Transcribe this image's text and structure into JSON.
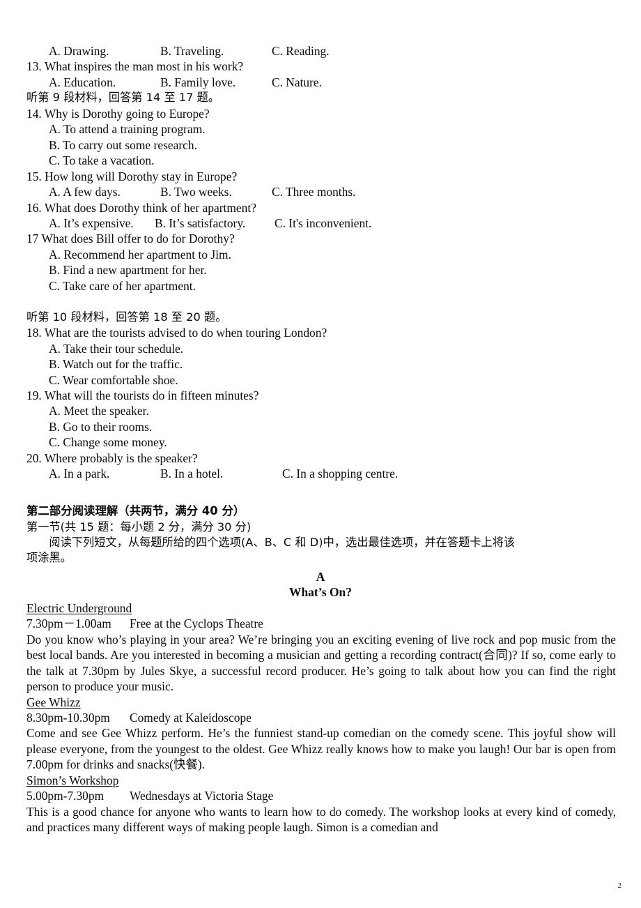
{
  "page": {
    "number": "2",
    "paper_type": "english-exam-paper"
  },
  "listening": {
    "q12_options": {
      "a": "A. Drawing.",
      "b": "B. Traveling.",
      "c": "C. Reading."
    },
    "q13": {
      "stem": "13. What inspires the man most in his work?",
      "options": {
        "a": "A. Education.",
        "b": "B. Family love.",
        "c": "C. Nature."
      }
    },
    "section9_instruction": "听第 9 段材料，回答第 14 至 17 题。",
    "q14": {
      "stem": "14. Why is Dorothy going to Europe?",
      "option_a": "A. To attend a training program.",
      "option_b": "B. To carry out some research.",
      "option_c": "C. To take a vacation."
    },
    "q15": {
      "stem": "15. How long will Dorothy stay in Europe?",
      "options": {
        "a": "A. A few days.",
        "b": "B. Two weeks.",
        "c": "C. Three months."
      }
    },
    "q16": {
      "stem": "16. What does Dorothy think of her apartment?",
      "options": {
        "a": "A. It’s expensive.",
        "b": "B. It’s satisfactory.",
        "c": "C. It's inconvenient."
      }
    },
    "q17": {
      "stem": "17 What does Bill offer to do for Dorothy?",
      "option_a": "A. Recommend her apartment to Jim.",
      "option_b": "B. Find a new apartment for her.",
      "option_c": "C. Take care of her apartment."
    },
    "section10_instruction": "听第 10 段材料，回答第 18 至 20 题。",
    "q18": {
      "stem": "18. What are the tourists advised to do when touring London?",
      "option_a": "A. Take their tour schedule.",
      "option_b": "B. Watch out for the traffic.",
      "option_c": "C. Wear comfortable shoe."
    },
    "q19": {
      "stem": "19. What will the tourists do in fifteen minutes?",
      "option_a": "A. Meet the speaker.",
      "option_b": "B. Go to their rooms.",
      "option_c": "C. Change some money."
    },
    "q20": {
      "stem": "20. Where probably is the speaker?",
      "options": {
        "a": "A. In a park.",
        "b": "B. In a hotel.",
        "c": "C. In a shopping centre."
      }
    }
  },
  "reading": {
    "part_heading": "第二部分阅读理解（共两节，满分 40 分）",
    "section_heading": "第一节(共 15 题：每小题 2 分，满分 30 分)",
    "instruction_line1": "　　阅读下列短文，从每题所给的四个选项(A、B、C 和 D)中，选出最佳选项，并在答题卡上将该",
    "instruction_line2": "项涂黑。",
    "passage_label": "A",
    "passage_title": "What’s On?",
    "listings": [
      {
        "name": "Electric Underground",
        "time_venue_time": "7.30pm－1.00am",
        "time_venue_place": "Free at the Cyclops Theatre",
        "body": "Do you know who’s playing in your area? We’re bringing you an exciting evening of live rock and pop music from the best local bands. Are you interested in becoming a musician and getting a recording contract(合同)? If so, come early to the talk at 7.30pm by Jules Skye, a successful record producer. He’s going to talk about how you can find the right person to produce your music."
      },
      {
        "name": "Gee Whizz",
        "time_venue_time": "8.30pm-10.30pm",
        "time_venue_place": "Comedy at Kaleidoscope",
        "body": "Come and see Gee Whizz perform. He’s the funniest stand-up comedian on the comedy scene. This joyful show will please everyone, from the youngest to the oldest. Gee Whizz really knows how to make you laugh! Our bar is open from 7.00pm for drinks and snacks(快餐)."
      },
      {
        "name": "Simon’s Workshop",
        "time_venue_time": "5.00pm-7.30pm",
        "time_venue_place": "Wednesdays at Victoria Stage",
        "body": "This is a good chance for anyone who wants to learn how to do comedy. The workshop looks at every kind of comedy, and practices many different ways of making people laugh. Simon is a comedian and"
      }
    ]
  }
}
